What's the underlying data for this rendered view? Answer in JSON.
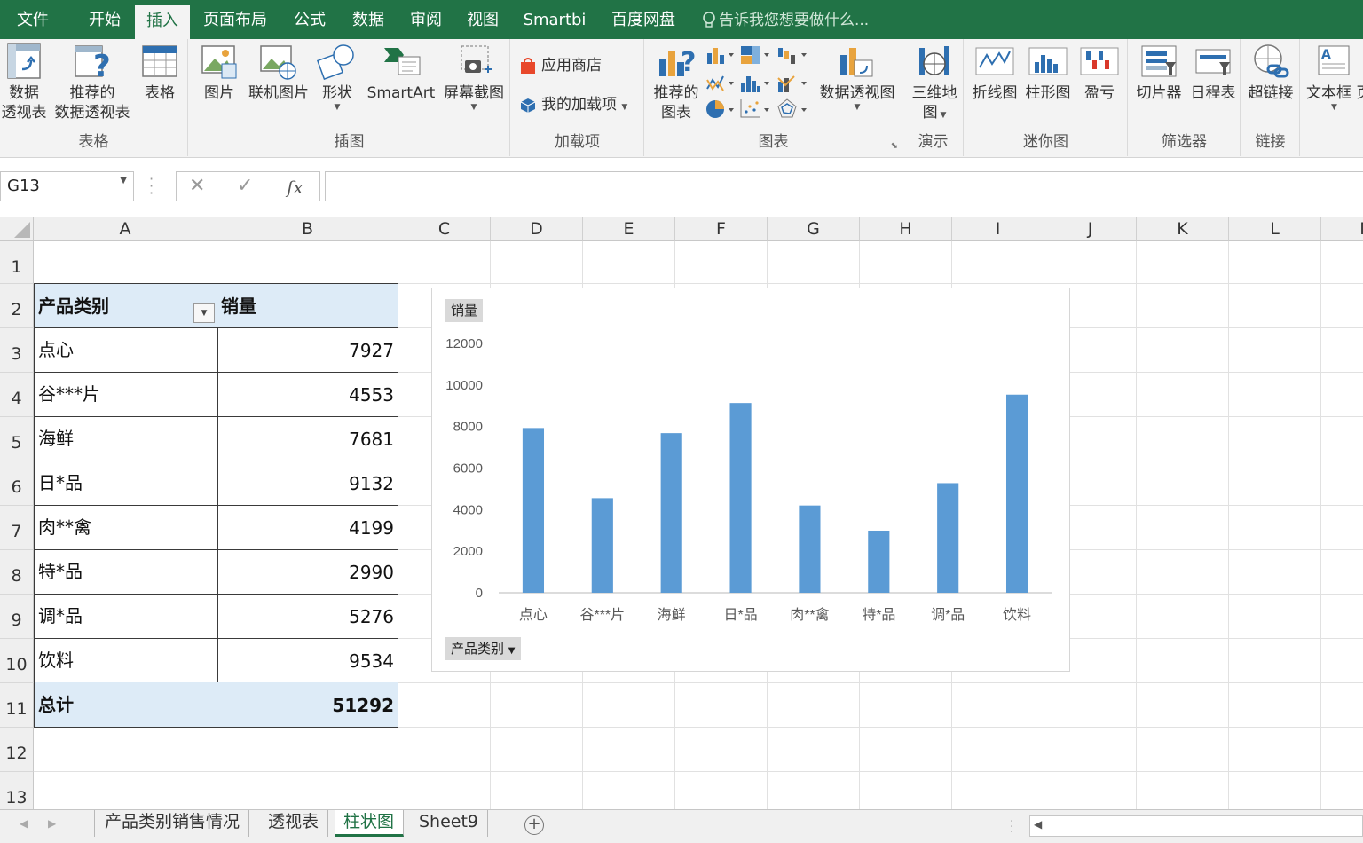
{
  "ribbon_tabs": [
    {
      "label": "文件"
    },
    {
      "label": "开始"
    },
    {
      "label": "插入"
    },
    {
      "label": "页面布局"
    },
    {
      "label": "公式"
    },
    {
      "label": "数据"
    },
    {
      "label": "审阅"
    },
    {
      "label": "视图"
    },
    {
      "label": "Smartbi"
    },
    {
      "label": "百度网盘"
    }
  ],
  "active_tab": "插入",
  "tell_me": "告诉我您想要做什么...",
  "ribbon": {
    "tables": {
      "group": "表格",
      "pivot_l1": "数据",
      "pivot_l2": "透视表",
      "rec_pivot_l1": "推荐的",
      "rec_pivot_l2": "数据透视表",
      "table": "表格"
    },
    "illustrations": {
      "group": "插图",
      "picture": "图片",
      "online_picture": "联机图片",
      "shapes": "形状",
      "smartart": "SmartArt",
      "screenshot": "屏幕截图"
    },
    "addins": {
      "group": "加载项",
      "store": "应用商店",
      "my_addins": "我的加载项"
    },
    "charts": {
      "group": "图表",
      "rec_l1": "推荐的",
      "rec_l2": "图表",
      "pivot_chart": "数据透视图"
    },
    "tours": {
      "group": "演示",
      "map_l1": "三维地",
      "map_l2": "图"
    },
    "sparklines": {
      "group": "迷你图",
      "line": "折线图",
      "column": "柱形图",
      "winloss": "盈亏"
    },
    "filters": {
      "group": "筛选器",
      "slicer": "切片器",
      "timeline": "日程表"
    },
    "links": {
      "group": "链接",
      "hyperlink": "超链接"
    },
    "text": {
      "textbox": "文本框"
    }
  },
  "formula_bar": {
    "name_box": "G13",
    "fx": "fx",
    "content": ""
  },
  "columns": [
    "A",
    "B",
    "C",
    "D",
    "E",
    "F",
    "G",
    "H",
    "I",
    "J",
    "K",
    "L",
    "M"
  ],
  "rows": [
    "1",
    "2",
    "3",
    "4",
    "5",
    "6",
    "7",
    "8",
    "9",
    "10",
    "11",
    "12",
    "13"
  ],
  "pivot_table": {
    "header_category": "产品类别",
    "header_value": "销量",
    "rows": [
      {
        "category": "点心",
        "value": "7927"
      },
      {
        "category": "谷***片",
        "value": "4553"
      },
      {
        "category": "海鲜",
        "value": "7681"
      },
      {
        "category": "日*品",
        "value": "9132"
      },
      {
        "category": "肉**禽",
        "value": "4199"
      },
      {
        "category": "特*品",
        "value": "2990"
      },
      {
        "category": "调*品",
        "value": "5276"
      },
      {
        "category": "饮料",
        "value": "9534"
      }
    ],
    "total_label": "总计",
    "total_value": "51292"
  },
  "chart_data": {
    "type": "bar",
    "categories": [
      "点心",
      "谷***片",
      "海鲜",
      "日*品",
      "肉**禽",
      "特*品",
      "调*品",
      "饮料"
    ],
    "series": [
      {
        "name": "销量",
        "values": [
          7927,
          4553,
          7681,
          9132,
          4199,
          2990,
          5276,
          9534
        ]
      }
    ],
    "y_ticks": [
      0,
      2000,
      4000,
      6000,
      8000,
      10000,
      12000
    ],
    "ylim": [
      0,
      12000
    ],
    "grid": false,
    "legend": "none",
    "bar_color": "#5b9bd5",
    "value_field_button": "销量",
    "category_field_button": "产品类别"
  },
  "sheet_tabs": [
    {
      "label": "产品类别销售情况"
    },
    {
      "label": "透视表"
    },
    {
      "label": "柱状图"
    },
    {
      "label": "Sheet9"
    }
  ],
  "active_sheet": "柱状图",
  "colors": {
    "accent": "#217346",
    "header_fill": "#ddebf7",
    "bar": "#5b9bd5"
  }
}
